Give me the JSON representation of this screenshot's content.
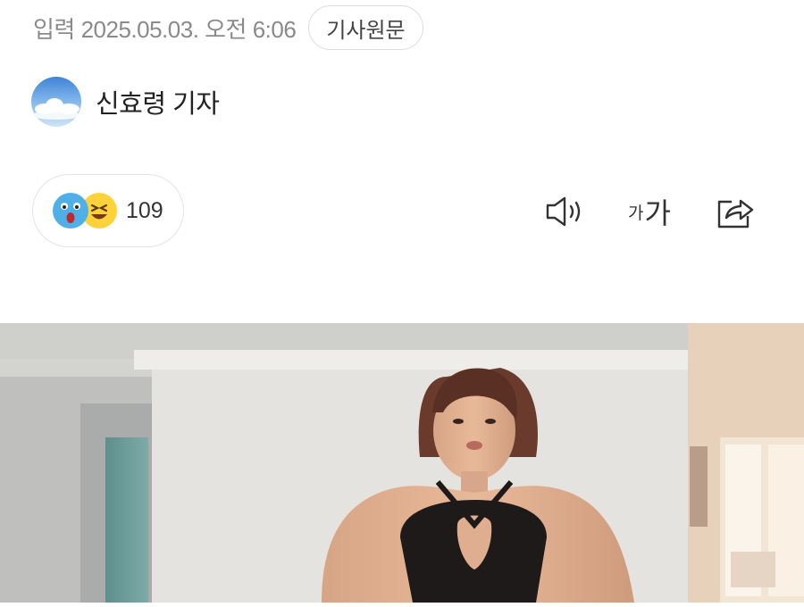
{
  "article": {
    "published_label": "입력 2025.05.03. 오전 6:06",
    "original_button": "기사원문",
    "reporter_name": "신효령 기자"
  },
  "reactions": {
    "count": "109",
    "icons": [
      "surprised-face-icon",
      "laughing-face-icon"
    ]
  },
  "toolbar": {
    "font_small": "가",
    "font_large": "가",
    "icons": [
      "speaker-icon",
      "font-size-icon",
      "share-icon"
    ]
  },
  "colors": {
    "meta_text": "#8a8a8a",
    "border": "#dcdcdc",
    "wow_emoji": "#4fb0e8",
    "laugh_emoji": "#ffd23c"
  }
}
